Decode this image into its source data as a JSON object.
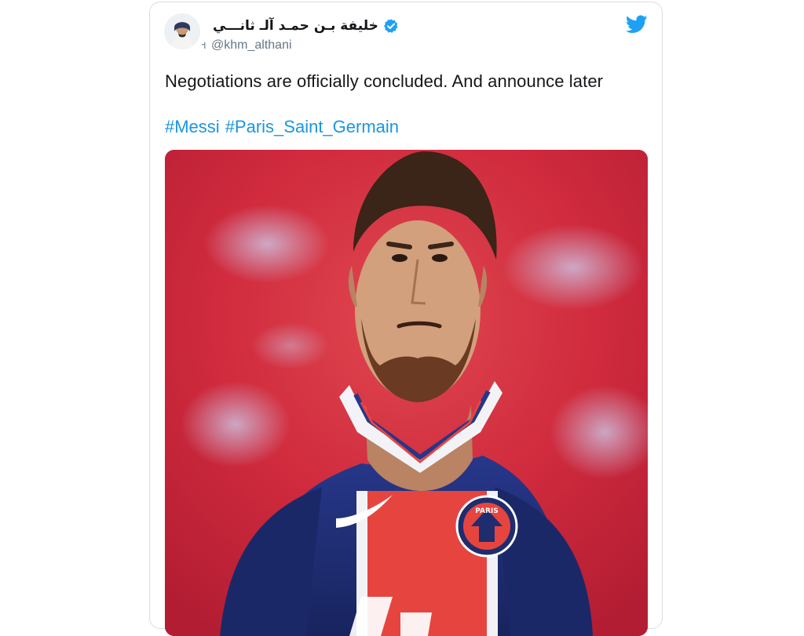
{
  "tweet": {
    "author": {
      "display_name": "خليفة بـن حمـد آلـ ثانـــي",
      "handle": "@khm_althani",
      "verified": true,
      "verified_icon": "verified-badge-icon",
      "avatar_icon": "avatar"
    },
    "platform_icon": "twitter-bird-icon",
    "text": "Negotiations are officially concluded. And announce later",
    "hashtags": [
      "#Messi",
      "#Paris_Saint_Germain"
    ],
    "media": {
      "kind": "photo",
      "jersey_badge_text": "PARIS"
    }
  },
  "colors": {
    "link": "#1b95e0",
    "verified": "#1da1f2",
    "text": "#14171a",
    "muted": "#657786",
    "border": "#d9dee3",
    "background_red": "#d22a3e",
    "jersey_navy": "#1f2d6e",
    "jersey_red": "#e6453f"
  }
}
